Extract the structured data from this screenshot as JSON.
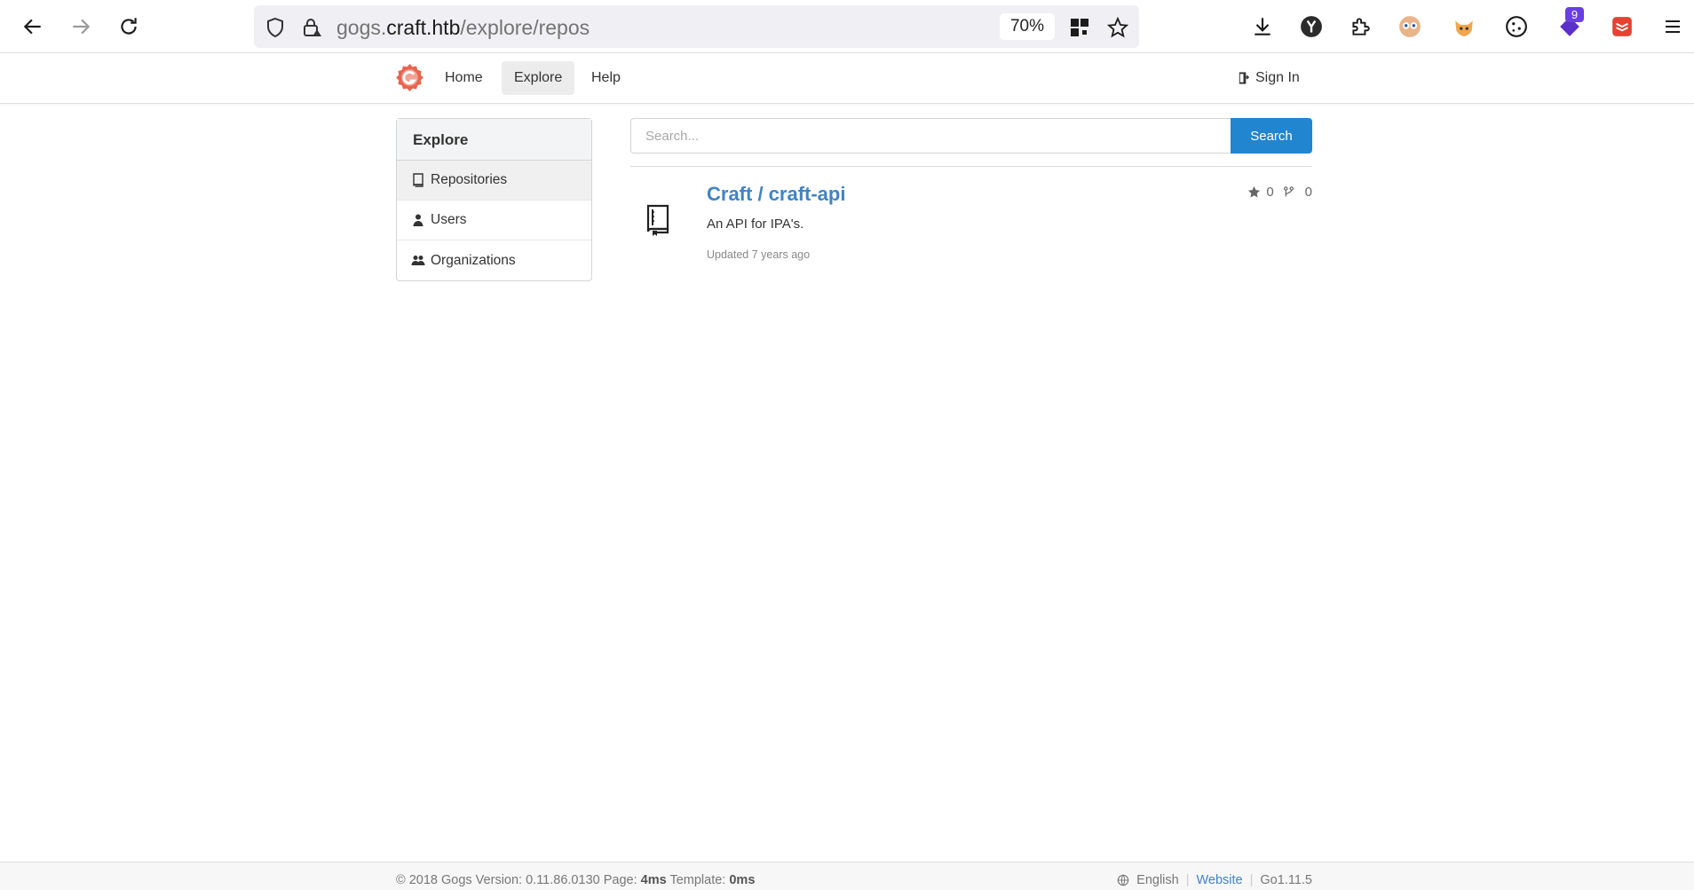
{
  "browser": {
    "url_prefix": "gogs.",
    "url_host": "craft.htb",
    "url_path": "/explore/repos",
    "zoom": "70%",
    "extension_badge": "9"
  },
  "header": {
    "nav": [
      "Home",
      "Explore",
      "Help"
    ],
    "sign_in": "Sign In"
  },
  "sidebar": {
    "title": "Explore",
    "items": [
      {
        "label": "Repositories",
        "icon": "book-icon",
        "active": true
      },
      {
        "label": "Users",
        "icon": "person-icon",
        "active": false
      },
      {
        "label": "Organizations",
        "icon": "organization-icon",
        "active": false
      }
    ]
  },
  "search": {
    "placeholder": "Search...",
    "button_label": "Search"
  },
  "repos": [
    {
      "name": "Craft / craft-api",
      "description": "An API for IPA's.",
      "updated": "Updated 7 years ago",
      "stars": "0",
      "forks": "0"
    }
  ],
  "footer": {
    "copyright": "© 2018 Gogs Version: 0.11.86.0130 Page: ",
    "page_time": "4ms",
    "template_label": " Template: ",
    "template_time": "0ms",
    "language": "English",
    "website": "Website",
    "go_version": "Go1.11.5"
  },
  "colors": {
    "accent": "#2185d0",
    "link": "#4183c4"
  }
}
